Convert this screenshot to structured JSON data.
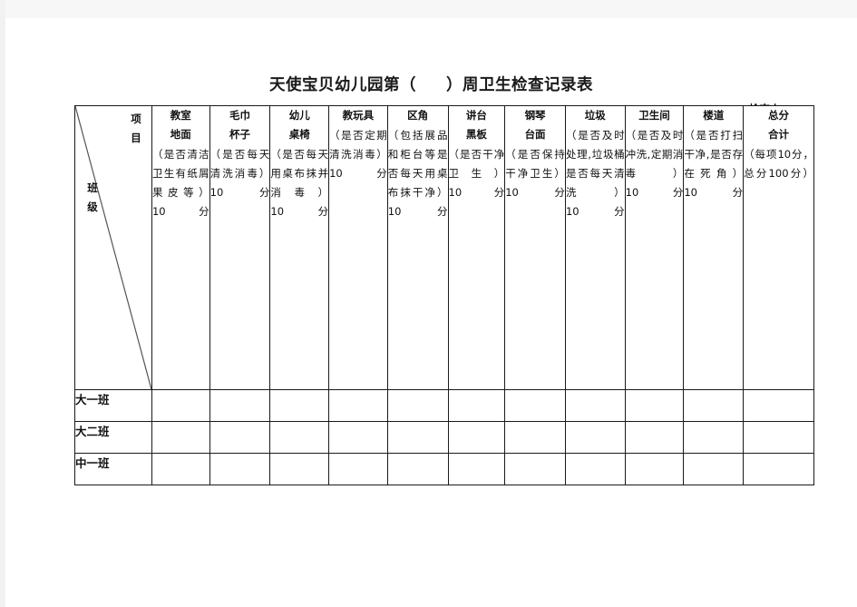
{
  "document": {
    "title": "天使宝贝幼儿园第（     ）周卫生检查记录表",
    "inspector_label": "检查人："
  },
  "table": {
    "corner": {
      "item_label": "项\n目",
      "class_label": "班\n级"
    },
    "columns": [
      {
        "name": "教室\n地面",
        "desc": "（是否清洁卫生有纸屑果皮等）\n10分",
        "justify": true
      },
      {
        "name": "毛巾\n杯子",
        "desc": "（是否每天清洗消毒）\n10分",
        "justify": true
      },
      {
        "name": "幼儿\n桌椅",
        "desc": "（是否每天用桌布抹并消毒）\n10分",
        "justify": true
      },
      {
        "name": "教玩具",
        "desc": "（是否定期清洗消毒）\n10分",
        "justify": true
      },
      {
        "name": "区角",
        "desc": "（包括展品和柜台等是否每天用桌布抹干净）\n10分",
        "justify": true
      },
      {
        "name": "讲台\n黑板",
        "desc": "（是否干净卫生）\n10分",
        "justify": true
      },
      {
        "name": "钢琴\n台面",
        "desc": "（是否保持干净卫生）\n10分",
        "justify": true
      },
      {
        "name": "垃圾",
        "desc": "（是否及时处理,垃圾桶是否每天清洗）\n10分",
        "justify": true
      },
      {
        "name": "卫生间",
        "desc": "（是否及时冲洗,定期消毒）\n10分",
        "justify": true
      },
      {
        "name": "楼道",
        "desc": "（是否打扫干净,是否存在死角）\n10分",
        "justify": true
      },
      {
        "name": "总分\n合计",
        "desc": "（每项10分，总分100分）",
        "justify": true
      }
    ],
    "rows": [
      {
        "label": "大一班",
        "values": [
          "",
          "",
          "",
          "",
          "",
          "",
          "",
          "",
          "",
          "",
          ""
        ]
      },
      {
        "label": "大二班",
        "values": [
          "",
          "",
          "",
          "",
          "",
          "",
          "",
          "",
          "",
          "",
          ""
        ]
      },
      {
        "label": "中一班",
        "values": [
          "",
          "",
          "",
          "",
          "",
          "",
          "",
          "",
          "",
          "",
          ""
        ]
      }
    ]
  },
  "colors": {
    "page_background": "#f7f7f7",
    "paper": "#ffffff",
    "border": "#1a1a1a",
    "text": "#111111"
  }
}
